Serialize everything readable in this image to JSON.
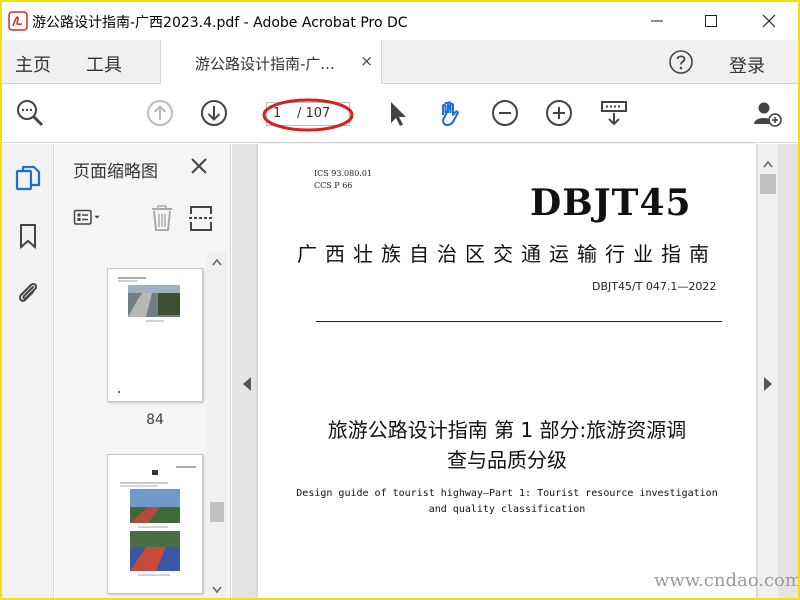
{
  "window": {
    "title": "游公路设计指南-广西2023.4.pdf - Adobe Acrobat Pro DC"
  },
  "menu": {
    "home": "主页",
    "tools": "工具",
    "tab_label": "游公路设计指南-广...",
    "tab_close": "×",
    "login": "登录"
  },
  "toolbar": {
    "page_current": "1",
    "page_total": "/ 107"
  },
  "thumbnails": {
    "title": "页面缩略图",
    "pages": [
      {
        "label": "84"
      },
      {
        "label": ""
      }
    ]
  },
  "document": {
    "ics": "ICS  93.080.01",
    "ccs": "CCS  P 66",
    "logo": "DBJT45",
    "authority": "广西壮族自治区交通运输行业指南",
    "number": "DBJT45/T 047.1—2022",
    "title_line1": "旅游公路设计指南  第 1 部分:旅游资源调",
    "title_line2": "查与品质分级",
    "en_line1": "Design guide of tourist highway—Part 1: Tourist resource investigation",
    "en_line2": "and quality classification"
  },
  "watermark": "www.cndao.com",
  "colors": {
    "frame": "#f1e20a",
    "accent_blue": "#1a6fd6",
    "annotation_red": "#d61f1f"
  },
  "icons": {
    "app": "acrobat-icon",
    "search": "zoom-search-icon",
    "prev_page": "arrow-up-circle-icon",
    "next_page": "arrow-down-circle-icon",
    "select": "cursor-arrow-icon",
    "hand": "hand-tool-icon",
    "zoom_out": "minus-circle-icon",
    "zoom_in": "plus-circle-icon",
    "fit": "fit-page-icon",
    "share_user": "add-user-icon"
  }
}
